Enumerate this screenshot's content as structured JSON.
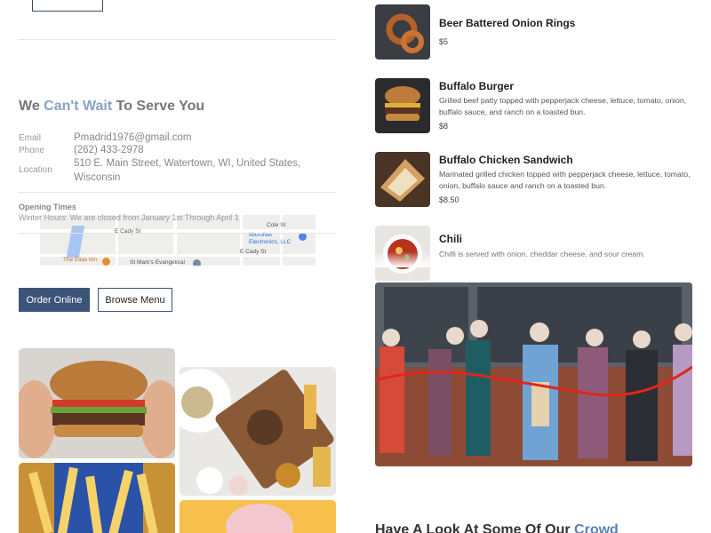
{
  "contact": {
    "title_prefix": "We",
    "title_accent": "Can't Wait",
    "title_suffix": "To Serve You",
    "email_label": "Email",
    "email_value": "Pmadrid1976@gmail.com",
    "phone_label": "Phone",
    "phone_value": "(262) 433-2978",
    "location_label": "Location",
    "location_value": "510 E. Main Street, Watertown, WI, United States, Wisconsin",
    "opening_title": "Opening Times",
    "opening_text": "Winter Hours: We are closed from January 1st Through April 1"
  },
  "map": {
    "labels": [
      "E Cady St",
      "Cole St",
      "MicroNet Electronics, LLC",
      "E Cady St",
      "The Elias Inn",
      "St Mark's Evangelical"
    ],
    "icons": [
      "pin-icon",
      "bed-icon",
      "church-icon"
    ]
  },
  "buttons": {
    "order_online": "Order Online",
    "browse_menu": "Browse Menu"
  },
  "menu": [
    {
      "name": "Beer Battered Onion Rings",
      "desc": "",
      "price": "$5",
      "image": "onion-rings-photo"
    },
    {
      "name": "Buffalo Burger",
      "desc": "Grilled beef patty topped with pepperjack cheese, lettuce, tomato, onion, buffalo sauce, and ranch on a toasted bun.",
      "price": "$8",
      "image": "burger-photo"
    },
    {
      "name": "Buffalo Chicken Sandwich",
      "desc": "Marinated grilled chicken topped with pepperjack cheese, lettuce, tomato, onion, buffalo sauce and ranch on a toasted bun.",
      "price": "$8.50",
      "image": "sandwich-photo"
    },
    {
      "name": "Chili",
      "desc": "Chilli is served with onion, cheddar cheese, and sour cream.",
      "price": "",
      "image": "chili-photo"
    }
  ],
  "crowd": {
    "title_prefix": "Have A Look At Some Of Our",
    "title_accent": "Crowd"
  },
  "colors": {
    "accent": "#8aa2c4",
    "primary_button": "#3c5478"
  }
}
